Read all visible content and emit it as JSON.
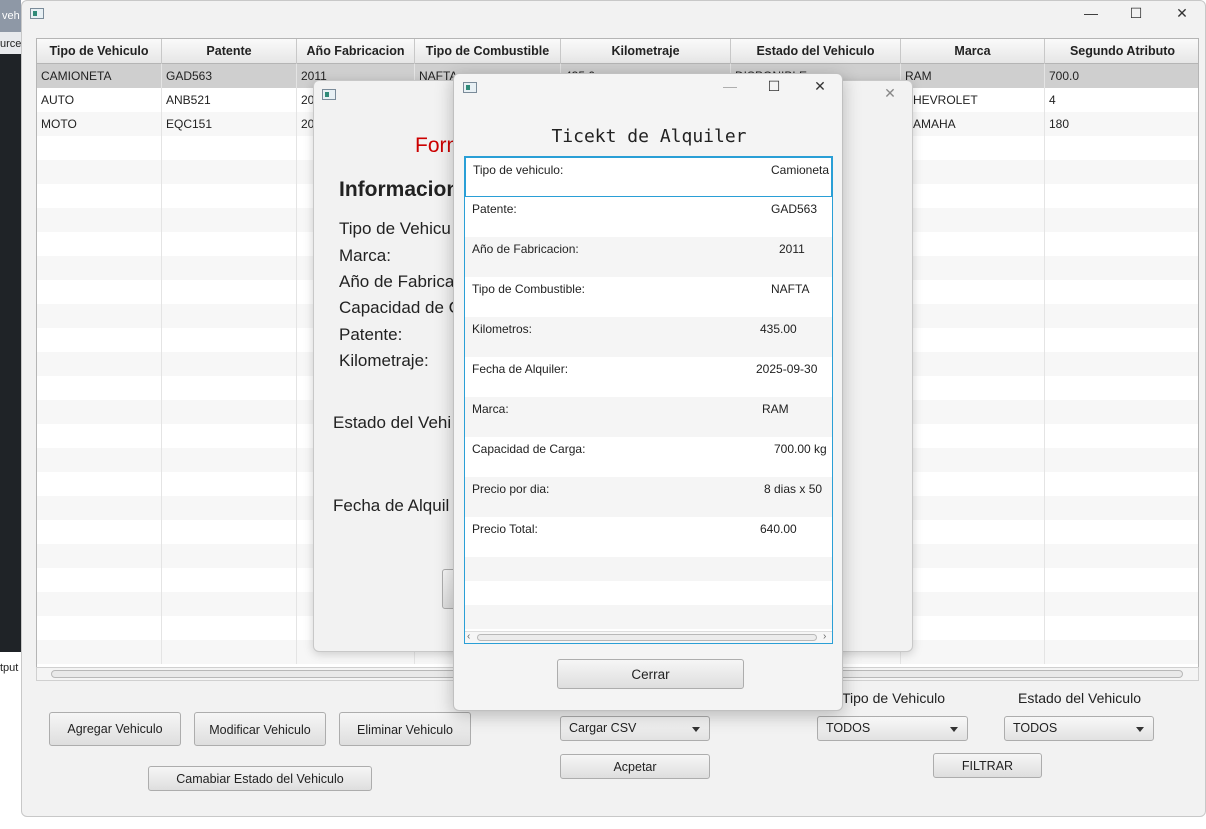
{
  "ide": {
    "tab": "veh",
    "sub": "urce",
    "output": "tput"
  },
  "main": {
    "controls": {
      "minimize": "—",
      "maximize": "☐",
      "close": "✕"
    },
    "columns": [
      "Tipo de Vehiculo",
      "Patente",
      "Año Fabricacion",
      "Tipo de Combustible",
      "Kilometraje",
      "Estado del Vehiculo",
      "Marca",
      "Segundo Atributo"
    ],
    "rows": [
      [
        "CAMIONETA",
        "GAD563",
        "2011",
        "NAFTA",
        "435.0",
        "DISPONIBLE",
        "RAM",
        "700.0"
      ],
      [
        "AUTO",
        "ANB521",
        "20",
        "",
        "",
        "",
        "HEVROLET",
        "4"
      ],
      [
        "MOTO",
        "EQC151",
        "20",
        "",
        "",
        "",
        "AMAHA",
        "180"
      ]
    ],
    "buttons": {
      "agregar": "Agregar Vehiculo",
      "modificar": "Modificar Vehiculo",
      "eliminar": "Eliminar Vehiculo",
      "cambiar_estado": "Camabiar Estado del Vehiculo",
      "aceptar": "Acpetar",
      "filtrar": "FILTRAR"
    },
    "combos": {
      "csv": "Cargar CSV",
      "tipo": "TODOS",
      "estado": "TODOS"
    },
    "labels": {
      "tipo": "Tipo de Vehiculo",
      "estado": "Estado del Vehiculo"
    }
  },
  "form": {
    "title": "Form",
    "heading": "Informacion",
    "fields": [
      "Tipo de Vehicu",
      "Marca:",
      "Año de Fabrica",
      "Capacidad de C",
      "Patente:",
      "Kilometraje:"
    ],
    "estado": "Estado del Vehi",
    "fecha": "Fecha de Alquil"
  },
  "ticket": {
    "title": "Ticekt de Alquiler",
    "items": [
      {
        "key": "Tipo de vehiculo:",
        "value": "Camioneta"
      },
      {
        "key": "Patente:",
        "value": "GAD563"
      },
      {
        "key": "Año de Fabricacion:",
        "value": "2011"
      },
      {
        "key": "Tipo de Combustible:",
        "value": "NAFTA"
      },
      {
        "key": "Kilometros:",
        "value": "435.00"
      },
      {
        "key": "Fecha de Alquiler:",
        "value": "2025-09-30"
      },
      {
        "key": "Marca:",
        "value": "RAM"
      },
      {
        "key": "Capacidad de Carga:",
        "value": "700.00 kg"
      },
      {
        "key": "Precio por dia:",
        "value": "8 dias x 50"
      },
      {
        "key": "Precio Total:",
        "value": "640.00"
      }
    ],
    "close_button": "Cerrar"
  }
}
